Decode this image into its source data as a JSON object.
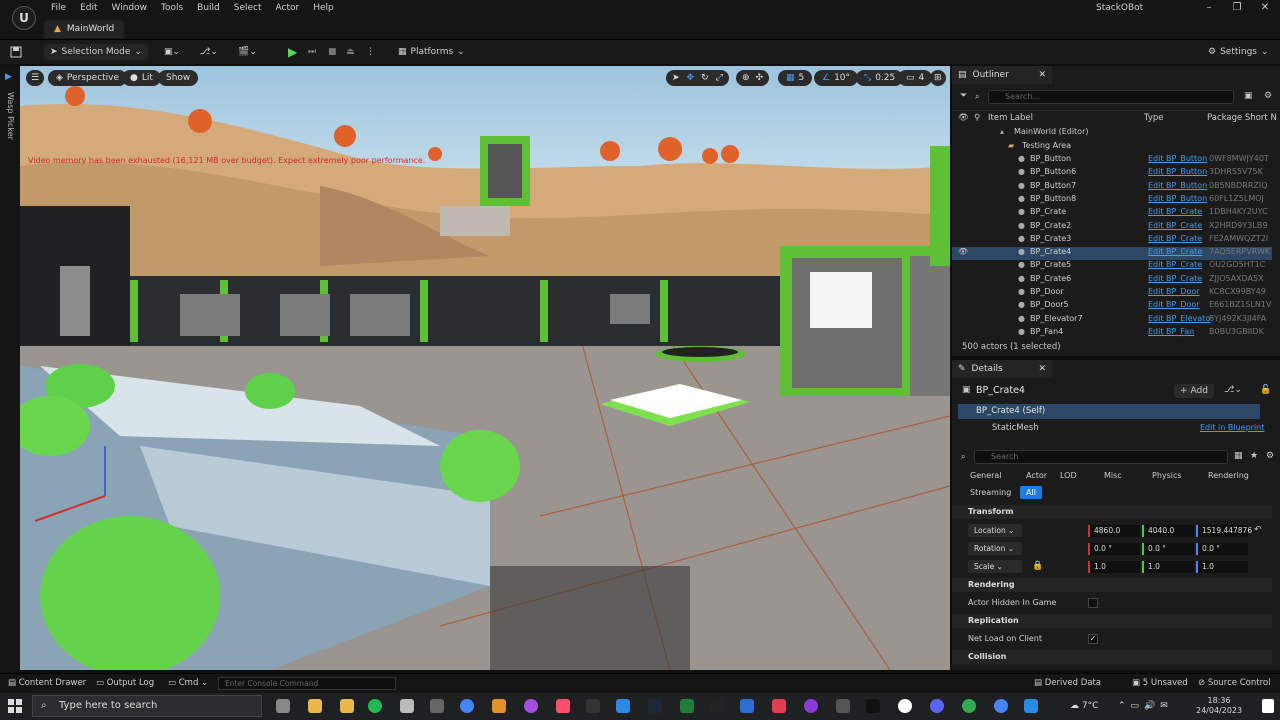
{
  "menu": [
    "File",
    "Edit",
    "Window",
    "Tools",
    "Build",
    "Select",
    "Actor",
    "Help"
  ],
  "app_name": "StackOBot",
  "level_tab": "MainWorld",
  "toolbar": {
    "selection_mode": "Selection Mode",
    "platforms": "Platforms",
    "settings": "Settings"
  },
  "left_strip": {
    "place_label": "Wasp Picker"
  },
  "viewport": {
    "perspective": "Perspective",
    "lit": "Lit",
    "show": "Show",
    "grid_snap": "5",
    "angle_snap": "10°",
    "scale_snap": "0.25",
    "camera_speed": "4",
    "warning": "Video memory has been exhausted (16,121 MB over budget). Expect extremely poor performance."
  },
  "outliner": {
    "tab": "Outliner",
    "search_placeholder": "Search...",
    "columns": {
      "label": "Item Label",
      "type": "Type",
      "package": "Package Short N"
    },
    "root": "MainWorld (Editor)",
    "folder": "Testing Area",
    "rows": [
      {
        "label": "BP_Button",
        "type": "Edit BP_Button",
        "pkg": "0WF8MWJY40T"
      },
      {
        "label": "BP_Button6",
        "type": "Edit BP_Button",
        "pkg": "3DHRS5V75K"
      },
      {
        "label": "BP_Button7",
        "type": "Edit BP_Button",
        "pkg": "0B5NBDRRZIQ"
      },
      {
        "label": "BP_Button8",
        "type": "Edit BP_Button",
        "pkg": "60FL1Z5LMOJ"
      },
      {
        "label": "BP_Crate",
        "type": "Edit BP_Crate",
        "pkg": "1DBH4KY2UYC"
      },
      {
        "label": "BP_Crate2",
        "type": "Edit BP_Crate",
        "pkg": "X2HRD9Y3LB9"
      },
      {
        "label": "BP_Crate3",
        "type": "Edit BP_Crate",
        "pkg": "FE2AMWQZT2I"
      },
      {
        "label": "BP_Crate4",
        "type": "Edit BP_Crate",
        "pkg": "7AQ5ERPVRWK"
      },
      {
        "label": "BP_Crate5",
        "type": "Edit BP_Crate",
        "pkg": "OU2GD5HT1C"
      },
      {
        "label": "BP_Crate6",
        "type": "Edit BP_Crate",
        "pkg": "ZJJO5AXDA5X"
      },
      {
        "label": "BP_Door",
        "type": "Edit BP_Door",
        "pkg": "KC8CX99BY49"
      },
      {
        "label": "BP_Door5",
        "type": "Edit BP_Door",
        "pkg": "E661BZ1SLN1V"
      },
      {
        "label": "BP_Elevator7",
        "type": "Edit BP_Elevato",
        "pkg": "8YJ492K3JI4FA"
      },
      {
        "label": "BP_Fan4",
        "type": "Edit BP_Fan",
        "pkg": "B0BU3GBIIDK"
      }
    ],
    "actor_count": "500 actors (1 selected)"
  },
  "details": {
    "tab": "Details",
    "actor": "BP_Crate4",
    "add": "Add",
    "self": "BP_Crate4 (Self)",
    "component": "StaticMesh",
    "edit_bp": "Edit in Blueprint",
    "search_placeholder": "Search",
    "filters": [
      "General",
      "Actor",
      "LOD",
      "Misc",
      "Physics",
      "Rendering"
    ],
    "filters2": [
      "Streaming",
      "All"
    ],
    "transform": "Transform",
    "location": {
      "label": "Location",
      "x": "4860.0",
      "y": "4040.0",
      "z": "1519.447876"
    },
    "rotation": {
      "label": "Rotation",
      "x": "0.0 °",
      "y": "0.0 °",
      "z": "0.0 °"
    },
    "scale": {
      "label": "Scale",
      "x": "1.0",
      "y": "1.0",
      "z": "1.0"
    },
    "rendering": "Rendering",
    "hidden": "Actor Hidden In Game",
    "replication": "Replication",
    "net_load": "Net Load on Client",
    "collision": "Collision"
  },
  "statusbar": {
    "content_drawer": "Content Drawer",
    "output_log": "Output Log",
    "cmd": "Cmd",
    "cmd_placeholder": "Enter Console Command",
    "derived": "Derived Data",
    "unsaved": "5 Unsaved",
    "source": "Source Control"
  },
  "taskbar": {
    "search": "Type here to search",
    "temp": "7°C",
    "time": "18:36",
    "date": "24/04/2023"
  }
}
